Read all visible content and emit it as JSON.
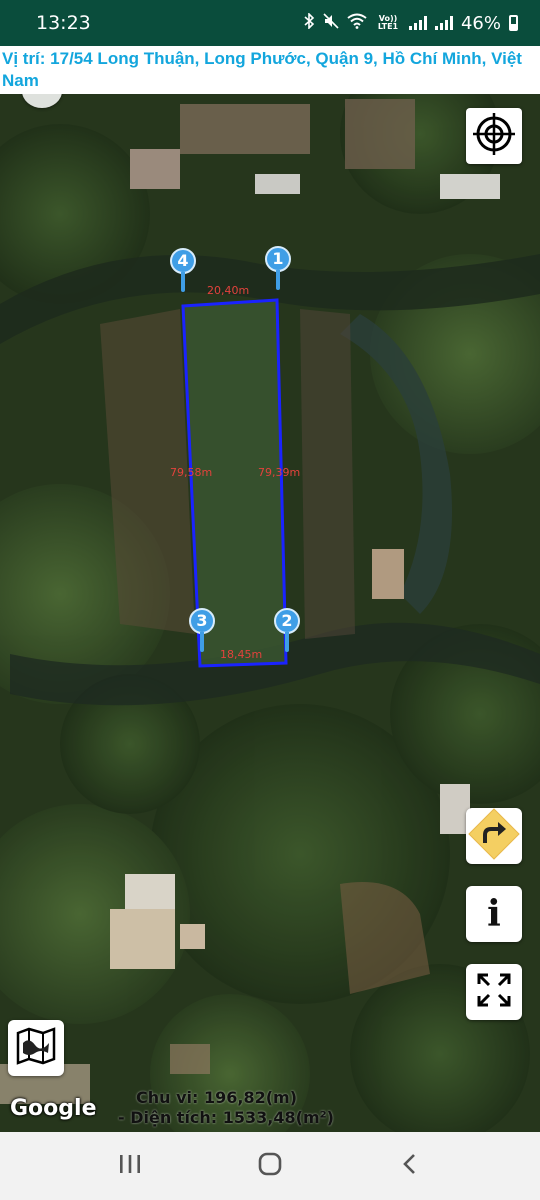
{
  "status_bar": {
    "time": "13:23",
    "volte_label": "Vo)) LTE1",
    "battery_percent": "46%",
    "icons": [
      "bluetooth-icon",
      "mute-icon",
      "wifi-icon",
      "signal-icon",
      "battery-icon"
    ]
  },
  "header": {
    "address_text": "Vị trí: 17/54 Long Thuận, Long Phước, Quận 9, Hồ Chí Minh, Việt Nam"
  },
  "map": {
    "provider_logo": "Google",
    "markers": [
      {
        "label": "1"
      },
      {
        "label": "2"
      },
      {
        "label": "3"
      },
      {
        "label": "4"
      }
    ],
    "edge_labels": {
      "top": "20,40m",
      "left": "79,58m",
      "right": "79,39m",
      "bottom": "18,45m"
    },
    "polygon_color": "#1a23ff",
    "label_color": "#e3423c",
    "marker_color": "#3f9ee6"
  },
  "measurements": {
    "perimeter": "Chu vi: 196,82(m)",
    "area": "- Diện tích: 1533,48(m²)"
  },
  "controls": {
    "locate": "crosshair-target-icon",
    "directions": "turn-right-sign-icon",
    "info": "i",
    "fullscreen": "expand-arrows-icon",
    "map_type": "folded-map-icon"
  },
  "nav_bar": {
    "icons": [
      "recents-icon",
      "home-icon",
      "back-icon"
    ]
  }
}
